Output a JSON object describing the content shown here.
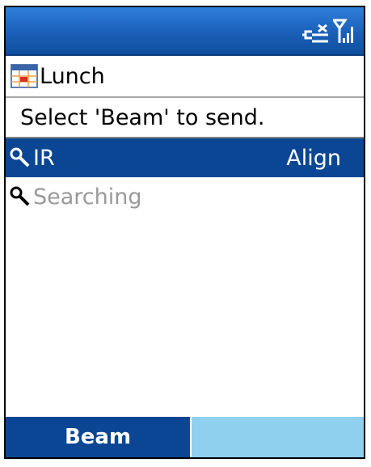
{
  "colors": {
    "status_bar": "#1a5fb8",
    "selection": "#0a4694",
    "softkey_left": "#0a4694",
    "softkey_right": "#8fd0ee",
    "dim_text": "#9a9a9a"
  },
  "status_bar": {
    "icons": [
      "no-connection-icon",
      "signal-strength-icon"
    ]
  },
  "header": {
    "icon": "calendar-icon",
    "title": "Lunch"
  },
  "instruction": "Select 'Beam' to send.",
  "devices": [
    {
      "icon": "search-icon",
      "label": "IR",
      "status": "Align",
      "selected": true
    },
    {
      "icon": "search-icon",
      "label": "Searching",
      "status": "",
      "selected": false
    }
  ],
  "softkeys": {
    "left": "Beam",
    "right": ""
  }
}
